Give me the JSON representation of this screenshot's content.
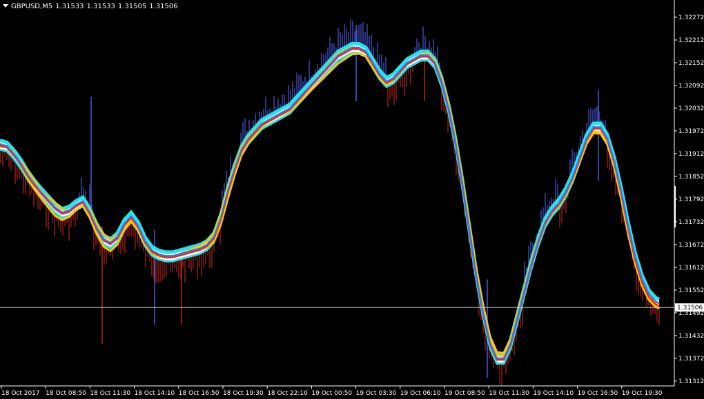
{
  "header": {
    "symbol": "GBPUSD,M5",
    "open": "1.31533",
    "high": "1.31533",
    "low": "1.31505",
    "close": "1.31506"
  },
  "colors": {
    "background": "#000000",
    "axis": "#ffffff",
    "bull_bar": "#4a5ad8",
    "bear_bar": "#b0241c",
    "band_main": "#ffffff",
    "band_accent": "#22e6ee",
    "ma_gold": "#ffc800",
    "ma_red": "#ff2000",
    "ma_blue": "#3e6ef0",
    "current_price_line": "#c8c8c8"
  },
  "chart_data": {
    "type": "line",
    "ylim": [
      1.3131,
      1.32272
    ],
    "y_ticks": [
      "1.32272",
      "1.32212",
      "1.32152",
      "1.32092",
      "1.32032",
      "1.31972",
      "1.31912",
      "1.31852",
      "1.31792",
      "1.31732",
      "1.31672",
      "1.31612",
      "1.31552",
      "1.31492",
      "1.31432",
      "1.31372",
      "1.31312"
    ],
    "x_ticks": [
      "18 Oct 2017",
      "18 Oct 08:50",
      "18 Oct 11:30",
      "18 Oct 14:10",
      "18 Oct 16:50",
      "18 Oct 19:30",
      "18 Oct 22:10",
      "19 Oct 00:50",
      "19 Oct 03:30",
      "19 Oct 06:10",
      "19 Oct 08:50",
      "19 Oct 11:30",
      "19 Oct 14:10",
      "19 Oct 16:50",
      "19 Oct 19:30"
    ],
    "current_price": "1.31506",
    "band_center": {
      "x": [
        0,
        10,
        20,
        30,
        40,
        50,
        60,
        70,
        80,
        90,
        100,
        110,
        120,
        130,
        140,
        150,
        160,
        170,
        180,
        190,
        200,
        210,
        220,
        230,
        240,
        250,
        260,
        270,
        280,
        290,
        300,
        310,
        320,
        330,
        340,
        350,
        360,
        370,
        380,
        390,
        400,
        410,
        420,
        430,
        440,
        450,
        460,
        470,
        480,
        490,
        500,
        510,
        520,
        530,
        540,
        550,
        560,
        570,
        580,
        590,
        600,
        610,
        620,
        630,
        640,
        650,
        660,
        670,
        680,
        690,
        700,
        710,
        720,
        730,
        740,
        750,
        760,
        770,
        780,
        790,
        800,
        810,
        820,
        830,
        840,
        850,
        860,
        870,
        880,
        890,
        900,
        910,
        920,
        930,
        940,
        950,
        955
      ],
      "y": [
        1.31935,
        1.3193,
        1.3191,
        1.31885,
        1.31855,
        1.3183,
        1.31808,
        1.31788,
        1.31768,
        1.31755,
        1.3176,
        1.31775,
        1.31785,
        1.31755,
        1.31715,
        1.31685,
        1.31675,
        1.3169,
        1.31725,
        1.31745,
        1.3172,
        1.3168,
        1.31655,
        1.31645,
        1.3164,
        1.3164,
        1.31645,
        1.3165,
        1.31655,
        1.3166,
        1.3167,
        1.3169,
        1.3174,
        1.3181,
        1.3187,
        1.3192,
        1.3195,
        1.3197,
        1.3199,
        1.32,
        1.3201,
        1.3202,
        1.3203,
        1.3205,
        1.3207,
        1.3209,
        1.3211,
        1.3213,
        1.3215,
        1.3217,
        1.3218,
        1.3219,
        1.3219,
        1.3218,
        1.3215,
        1.3212,
        1.321,
        1.3211,
        1.3213,
        1.3215,
        1.3216,
        1.3217,
        1.3217,
        1.3215,
        1.321,
        1.3203,
        1.3194,
        1.3183,
        1.3171,
        1.3159,
        1.3149,
        1.3141,
        1.3137,
        1.3137,
        1.3141,
        1.3148,
        1.3155,
        1.3162,
        1.3168,
        1.3173,
        1.3176,
        1.3178,
        1.3181,
        1.3185,
        1.319,
        1.3195,
        1.3198,
        1.3198,
        1.3195,
        1.3189,
        1.3181,
        1.3172,
        1.3164,
        1.3158,
        1.3154,
        1.3152,
        1.31515
      ]
    },
    "ma_lines": [
      {
        "color_key": "ma_gold",
        "offsets": [
          -5e-05,
          0,
          -4e-05,
          6e-05,
          0.00012,
          0.0001,
          4e-05,
          8e-05,
          0.00015,
          0.0001,
          2e-05,
          -3e-05,
          2e-05,
          8e-05,
          0.00012,
          0.00015,
          0.0001,
          5e-05,
          -4e-05,
          -8e-05,
          -0.0001,
          -8e-05,
          -5e-05,
          -3e-05,
          -2e-05,
          0,
          2e-05,
          2e-05,
          0,
          -2e-05,
          -5e-05,
          -0.0001,
          -0.00015,
          -0.00018,
          -0.00015,
          -0.00012,
          -0.0001,
          -8e-05,
          -6e-05,
          -4e-05,
          -3e-05,
          -2e-05,
          -1e-05,
          0,
          1e-05,
          2e-05,
          3e-05,
          4e-05,
          5e-05,
          6e-05,
          5e-05,
          3e-05,
          1e-05,
          -1e-05,
          -3e-05,
          -4e-05,
          -5e-05,
          -4e-05,
          -3e-05,
          -2e-05,
          -1e-05,
          0,
          1e-05,
          2e-05,
          4e-05,
          6e-05,
          8e-05,
          0.0001,
          0.00012,
          0.00014,
          0.00014,
          0.00012,
          0.0001,
          8e-05,
          6e-05,
          4e-05,
          2e-05,
          0,
          -2e-05,
          -3e-05,
          -4e-05,
          -5e-05,
          -6e-05,
          -8e-05,
          -0.0001,
          -0.00012,
          -0.00014,
          -0.00015,
          -0.00014,
          -0.00012,
          -0.0001,
          -8e-05,
          -6e-05,
          -4e-05,
          -2e-05,
          -1e-05,
          0
        ]
      },
      {
        "color_key": "ma_gold",
        "offsets": [
          3e-05,
          2e-05,
          5e-05,
          -3e-05,
          -8e-05,
          -0.00012,
          -0.00015,
          -0.00018,
          -0.0002,
          -0.00018,
          -0.00015,
          -0.00012,
          -0.0001,
          -0.00012,
          -0.00015,
          -0.00018,
          -0.0002,
          -0.00018,
          -0.00015,
          -0.00012,
          -0.0001,
          -8e-05,
          -6e-05,
          -4e-05,
          -2e-05,
          0,
          2e-05,
          4e-05,
          6e-05,
          8e-05,
          0.0001,
          0.00012,
          0.00014,
          0.00012,
          0.0001,
          8e-05,
          6e-05,
          4e-05,
          2e-05,
          0,
          -2e-05,
          -4e-05,
          -6e-05,
          -8e-05,
          -0.0001,
          -0.00012,
          -0.00014,
          -0.00016,
          -0.00018,
          -0.0002,
          -0.00018,
          -0.00016,
          -0.00014,
          -0.00012,
          -0.0001,
          -8e-05,
          -6e-05,
          -4e-05,
          -2e-05,
          0,
          2e-05,
          4e-05,
          6e-05,
          8e-05,
          0.0001,
          0.00012,
          0.00014,
          0.00016,
          0.00018,
          0.0002,
          0.00022,
          0.0002,
          0.00018,
          0.00016,
          0.00014,
          0.00012,
          0.0001,
          8e-05,
          6e-05,
          4e-05,
          2e-05,
          0,
          -2e-05,
          -4e-05,
          -6e-05,
          -8e-05,
          -0.0001,
          -0.00012,
          -0.00014,
          -0.00016,
          -0.00018,
          -0.0002,
          -0.00018,
          -0.00016,
          -0.00014,
          -0.00012,
          -0.0001
        ]
      },
      {
        "color_key": "ma_red",
        "offsets": [
          -2e-05,
          -2e-05,
          -2e-05,
          -2e-05,
          -2e-05,
          -2e-05,
          -2e-05,
          -2e-05,
          -2e-05,
          -2e-05,
          -2e-05,
          -2e-05,
          -2e-05,
          -2e-05,
          -2e-05,
          -2e-05,
          -2e-05,
          -2e-05,
          -2e-05,
          -2e-05,
          -2e-05,
          -2e-05,
          -2e-05,
          -2e-05,
          -2e-05,
          -2e-05,
          -2e-05,
          -2e-05,
          -2e-05,
          -2e-05,
          -2e-05,
          -2e-05,
          -2e-05,
          -2e-05,
          -2e-05,
          -2e-05,
          -2e-05,
          -2e-05,
          -2e-05,
          -2e-05,
          -2e-05,
          -2e-05,
          -2e-05,
          -2e-05,
          -2e-05,
          -2e-05,
          -2e-05,
          -2e-05,
          -2e-05,
          -2e-05,
          -2e-05,
          -2e-05,
          -2e-05,
          -2e-05,
          -2e-05,
          -2e-05,
          -2e-05,
          -2e-05,
          -2e-05,
          -2e-05,
          -2e-05,
          -2e-05,
          -2e-05,
          -2e-05,
          -2e-05,
          -2e-05,
          -2e-05,
          -2e-05,
          -2e-05,
          -2e-05,
          -2e-05,
          -2e-05,
          -2e-05,
          -2e-05,
          -2e-05,
          -2e-05,
          -2e-05,
          -2e-05,
          -2e-05,
          -2e-05,
          -2e-05,
          -2e-05,
          -2e-05,
          -2e-05,
          -2e-05,
          -2e-05,
          -2e-05,
          -2e-05,
          -2e-05,
          -2e-05,
          -2e-05,
          -4e-05,
          -6e-05,
          -6e-05,
          -6e-05,
          -6e-05,
          -6e-05
        ]
      },
      {
        "color_key": "ma_blue",
        "offsets": [
          2e-05,
          2e-05,
          2e-05,
          2e-05,
          2e-05,
          2e-05,
          2e-05,
          2e-05,
          2e-05,
          2e-05,
          2e-05,
          2e-05,
          2e-05,
          2e-05,
          2e-05,
          2e-05,
          2e-05,
          2e-05,
          2e-05,
          2e-05,
          2e-05,
          2e-05,
          2e-05,
          2e-05,
          2e-05,
          2e-05,
          2e-05,
          2e-05,
          2e-05,
          2e-05,
          2e-05,
          2e-05,
          2e-05,
          2e-05,
          2e-05,
          2e-05,
          2e-05,
          2e-05,
          2e-05,
          2e-05,
          2e-05,
          2e-05,
          2e-05,
          2e-05,
          2e-05,
          2e-05,
          2e-05,
          2e-05,
          2e-05,
          2e-05,
          2e-05,
          2e-05,
          2e-05,
          2e-05,
          2e-05,
          2e-05,
          2e-05,
          2e-05,
          2e-05,
          2e-05,
          2e-05,
          2e-05,
          2e-05,
          2e-05,
          2e-05,
          2e-05,
          2e-05,
          2e-05,
          2e-05,
          2e-05,
          2e-05,
          2e-05,
          2e-05,
          2e-05,
          2e-05,
          2e-05,
          2e-05,
          2e-05,
          2e-05,
          2e-05,
          2e-05,
          2e-05,
          2e-05,
          2e-05,
          2e-05,
          2e-05,
          2e-05,
          2e-05,
          2e-05,
          2e-05,
          2e-05,
          2e-05,
          2e-05,
          2e-05,
          2e-05,
          2e-05,
          2e-05
        ]
      }
    ],
    "band_half_width": 0.00012,
    "histogram": {
      "bull_segments": [
        [
          115,
          135
        ],
        [
          320,
          560
        ],
        [
          600,
          640
        ],
        [
          760,
          810
        ],
        [
          825,
          880
        ]
      ],
      "bear_segments": [
        [
          0,
          115
        ],
        [
          135,
          300
        ],
        [
          560,
          600
        ],
        [
          640,
          760
        ],
        [
          810,
          825
        ],
        [
          880,
          960
        ]
      ],
      "spikes": [
        {
          "x": 132,
          "high": 1.32062,
          "low": 1.3176
        },
        {
          "x": 148,
          "high": 1.3172,
          "low": 1.3141
        },
        {
          "x": 224,
          "high": 1.3171,
          "low": 1.3146
        },
        {
          "x": 263,
          "high": 1.3166,
          "low": 1.3146
        },
        {
          "x": 516,
          "high": 1.32252,
          "low": 1.3205
        },
        {
          "x": 615,
          "high": 1.3216,
          "low": 1.3205
        },
        {
          "x": 706,
          "high": 1.3158,
          "low": 1.3132
        },
        {
          "x": 867,
          "high": 1.3208,
          "low": 1.3184
        }
      ]
    }
  }
}
